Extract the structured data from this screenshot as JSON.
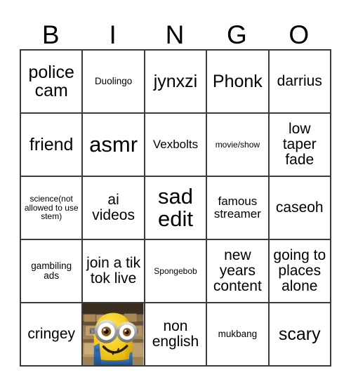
{
  "card": {
    "title": "BINGO",
    "headers": [
      "B",
      "I",
      "N",
      "G",
      "O"
    ],
    "rows": [
      [
        {
          "text": "police cam",
          "size": "lg"
        },
        {
          "text": "Duolingo",
          "size": "xs"
        },
        {
          "text": "jynxzi",
          "size": "lg"
        },
        {
          "text": "Phonk",
          "size": "lg"
        },
        {
          "text": "darrius",
          "size": "md"
        }
      ],
      [
        {
          "text": "friend",
          "size": "lg"
        },
        {
          "text": "asmr",
          "size": "xl"
        },
        {
          "text": "Vexbolts",
          "size": "sm"
        },
        {
          "text": "movie/show",
          "size": "xxs"
        },
        {
          "text": "low taper fade",
          "size": "md"
        }
      ],
      [
        {
          "text": "science(not allowed to use stem)",
          "size": "xxs"
        },
        {
          "text": "ai videos",
          "size": "md"
        },
        {
          "text": "sad edit",
          "size": "xl"
        },
        {
          "text": "famous streamer",
          "size": "sm"
        },
        {
          "text": "caseoh",
          "size": "md"
        }
      ],
      [
        {
          "text": "gambiling ads",
          "size": "xs"
        },
        {
          "text": "join a tik tok live",
          "size": "md"
        },
        {
          "text": "Spongebob",
          "size": "xxs"
        },
        {
          "text": "new years content",
          "size": "md"
        },
        {
          "text": "going to places alone",
          "size": "md"
        }
      ],
      [
        {
          "text": "cringey",
          "size": "md"
        },
        {
          "text": "",
          "size": "md",
          "image": "minion-photo"
        },
        {
          "text": "non english",
          "size": "md"
        },
        {
          "text": "mukbang",
          "size": "xs"
        },
        {
          "text": "scary",
          "size": "lg"
        }
      ]
    ]
  },
  "colors": {
    "border": "#3a3a3a",
    "background": "#ffffff",
    "text": "#000000",
    "minion_body": "#f5cb1e",
    "minion_overalls": "#2f6aa8",
    "goggle_metal": "#b9b9b4",
    "warehouse_box": "#b08b5a"
  }
}
